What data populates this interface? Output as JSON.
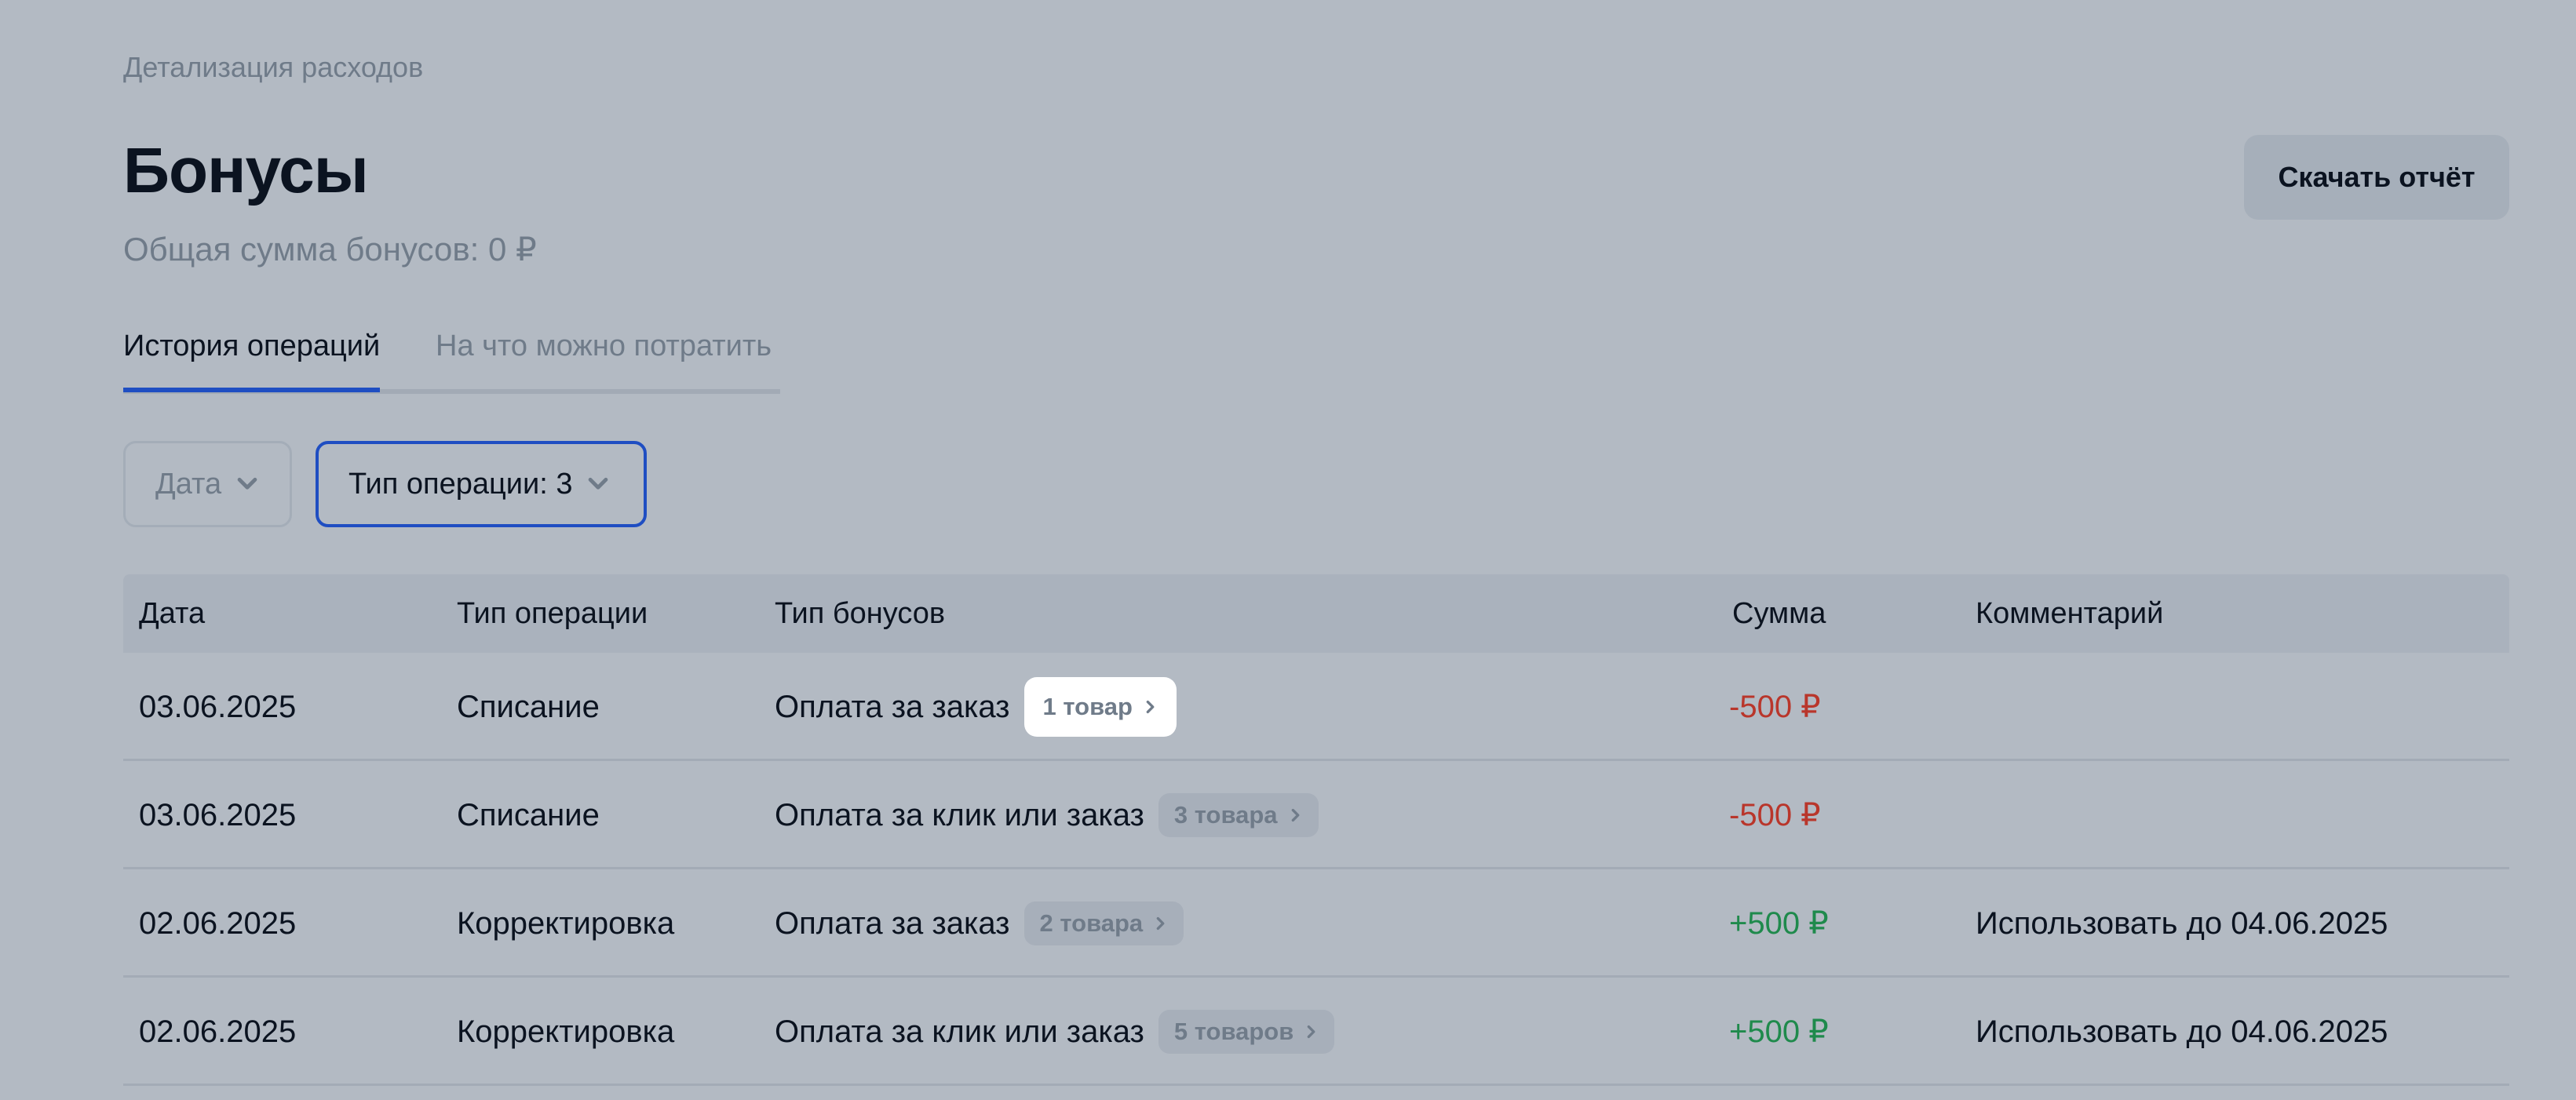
{
  "breadcrumb": "Детализация расходов",
  "page": {
    "title": "Бонусы",
    "subtitle": "Общая сумма бонусов: 0 ₽",
    "download_label": "Скачать отчёт"
  },
  "tabs": [
    {
      "label": "История операций",
      "active": true
    },
    {
      "label": "На что можно потратить",
      "active": false
    }
  ],
  "filters": {
    "date_label": "Дата",
    "type_label": "Тип операции: 3"
  },
  "table": {
    "headers": {
      "date": "Дата",
      "operation": "Тип операции",
      "bonus_type": "Тип бонусов",
      "sum": "Сумма",
      "comment": "Комментарий"
    },
    "rows": [
      {
        "date": "03.06.2025",
        "operation": "Списание",
        "bonus_type": "Оплата за заказ",
        "items": "1 товар",
        "sum": "-500 ₽",
        "sign": "negative",
        "comment": ""
      },
      {
        "date": "03.06.2025",
        "operation": "Списание",
        "bonus_type": "Оплата за клик или заказ",
        "items": "3 товара",
        "sum": "-500 ₽",
        "sign": "negative",
        "comment": ""
      },
      {
        "date": "02.06.2025",
        "operation": "Корректировка",
        "bonus_type": "Оплата за заказ",
        "items": "2 товара",
        "sum": "+500 ₽",
        "sign": "positive",
        "comment": "Использовать до 04.06.2025"
      },
      {
        "date": "02.06.2025",
        "operation": "Корректировка",
        "bonus_type": "Оплата за клик или заказ",
        "items": "5 товаров",
        "sum": "+500 ₽",
        "sign": "positive",
        "comment": "Использовать до 04.06.2025"
      }
    ]
  },
  "colors": {
    "accent": "#1f4ec2",
    "negative": "#b9362b",
    "positive": "#1f8a4c",
    "overlay_background": "#b3bac3"
  },
  "icons": {
    "dropdown": "chevron-down-icon",
    "pill": "chevron-right-icon"
  }
}
